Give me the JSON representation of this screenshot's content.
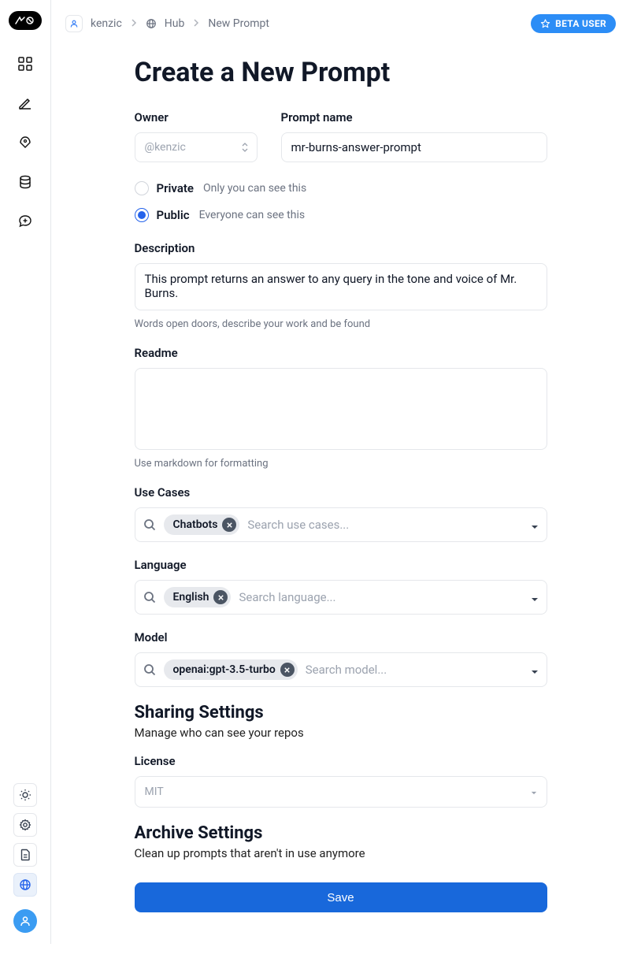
{
  "breadcrumb": {
    "user": "kenzic",
    "hub": "Hub",
    "current": "New Prompt"
  },
  "beta_badge": "BETA USER",
  "page": {
    "title": "Create a New Prompt"
  },
  "owner": {
    "label": "Owner",
    "placeholder": "@kenzic"
  },
  "prompt_name": {
    "label": "Prompt name",
    "value": "mr-burns-answer-prompt"
  },
  "visibility": {
    "private_label": "Private",
    "private_hint": "Only you can see this",
    "public_label": "Public",
    "public_hint": "Everyone can see this",
    "selected": "public"
  },
  "description": {
    "label": "Description",
    "value": "This prompt returns an answer to any query in the tone and voice of Mr. Burns.",
    "hint": "Words open doors, describe your work and be found"
  },
  "readme": {
    "label": "Readme",
    "value": "",
    "hint": "Use markdown for formatting"
  },
  "use_cases": {
    "label": "Use Cases",
    "chip": "Chatbots",
    "placeholder": "Search use cases..."
  },
  "language": {
    "label": "Language",
    "chip": "English",
    "placeholder": "Search language..."
  },
  "model": {
    "label": "Model",
    "chip": "openai:gpt-3.5-turbo",
    "placeholder": "Search model..."
  },
  "sharing": {
    "title": "Sharing Settings",
    "sub": "Manage who can see your repos"
  },
  "license": {
    "label": "License",
    "value": "MIT"
  },
  "archive": {
    "title": "Archive Settings",
    "sub": "Clean up prompts that aren't in use anymore"
  },
  "save_label": "Save"
}
